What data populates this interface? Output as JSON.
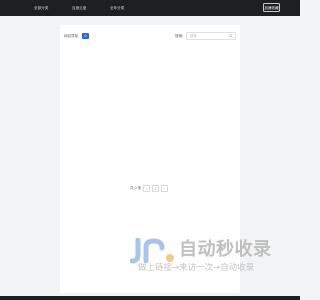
{
  "nav": {
    "items": [
      {
        "label": "全部分类"
      },
      {
        "label": "百度云盘"
      },
      {
        "label": "全年分类"
      }
    ],
    "login_label": "加速收藏"
  },
  "content": {
    "title": "网站导航",
    "badge": "0",
    "search_label": "搜索:",
    "search_placeholder": "搜索"
  },
  "pagination": {
    "total_text": "共 0 条",
    "prev_label": "‹",
    "page_label": "1",
    "next_label": "›"
  },
  "watermark": {
    "title": "自动秒收录",
    "slogan": "做上链接→来访一次→自动收录"
  },
  "colors": {
    "topbar": "#1e1f22",
    "accent": "#2f63d6",
    "page_bg": "#f2f3f5",
    "watermark_blue": "#a9c4ea",
    "watermark_orange": "#f3c98d"
  }
}
